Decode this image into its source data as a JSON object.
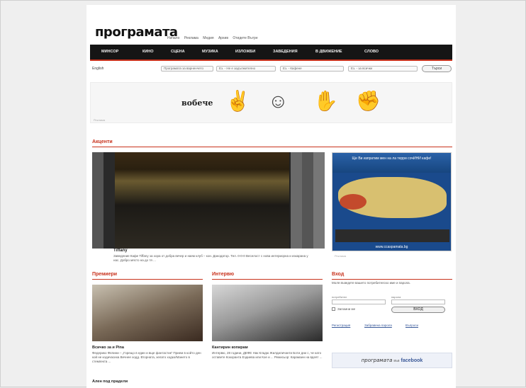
{
  "header": {
    "logo": "програмата",
    "top_links": [
      "Начало",
      "Реклама",
      "Медия",
      "Архив",
      "Отидете Вътре"
    ]
  },
  "nav": {
    "items": [
      "МИНСОР",
      "КИНО",
      "СЦЕНА",
      "МУЗИКА",
      "ИЗЛОЖБИ",
      "ЗАВЕДЕНИЯ",
      "В ДВИЖЕНИЕ",
      "СЛОВО"
    ]
  },
  "search": {
    "lang": "English",
    "selects": [
      "Програмата за варненчето",
      "Ез. - Не е задължително",
      "Ез. - Кафене",
      "Ез. - за всички"
    ],
    "button": "Търси"
  },
  "banner": {
    "label": "Реклама",
    "word": "вобече"
  },
  "accents": {
    "heading": "Акценти",
    "featured_title": "Tiffany",
    "featured_text": "Заведение Кафе Tiffany за хора от добра вечер и наем клуб – кон. Данодатор. Тел. 0-0-0 Веселост с нова интериорна и изкарана у нас. Добро място на до тя ..."
  },
  "ad": {
    "title": "Ще Ви изпратим мен на ла терри сочИНИ кафе!",
    "url": "www.ccaspamata.bg",
    "caption": "Реклама"
  },
  "premieres": {
    "heading": "Премиери",
    "title": "Всичко за и Pina",
    "text": "Федерико Фелини – „Горещо в един и вще фантастик“ Прием в който ден кой не кодичасиха Вечнее ходд. Вторната, хелато ходко/Мането в стемпекта ..."
  },
  "interviews": {
    "heading": "Интервю",
    "title": "Кантирин копирам",
    "text": "Интервю, 28 години, ДЕФЕ Нак Кладю Жилдиличанти Боти дни с, че като оставете Кокоранта Ездиева или Кое и ... Режисьор: Карамзин на вдеят ..."
  },
  "more": {
    "title": "Ален под прадели"
  },
  "login": {
    "heading": "Вход",
    "intro": "Моля въведете вашето потребителско име и парола.",
    "username_label": "потребител",
    "password_label": "парола",
    "remember": "Запомни ме",
    "button": "ВХОД",
    "links": [
      "Регистрация",
      "Забравена парола",
      "Въпроси"
    ]
  },
  "facebook": {
    "left": "програмата",
    "mid": "във",
    "right": "facebook"
  }
}
